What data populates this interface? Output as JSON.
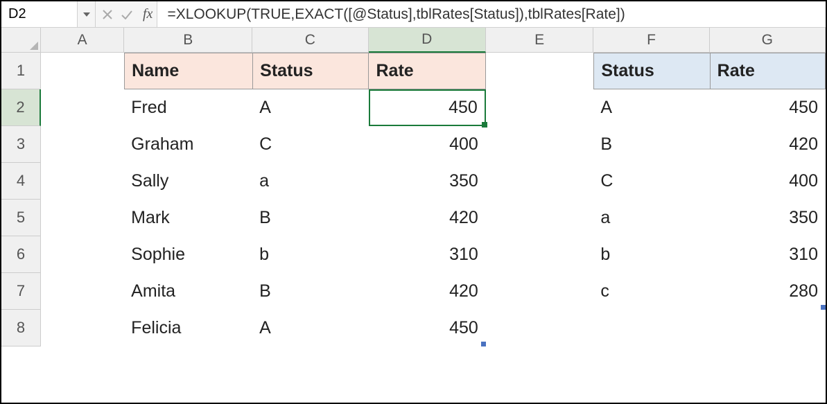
{
  "namebox": "D2",
  "fx_label": "fx",
  "formula": "=XLOOKUP(TRUE,EXACT([@Status],tblRates[Status]),tblRates[Rate])",
  "columns": [
    "A",
    "B",
    "C",
    "D",
    "E",
    "F",
    "G"
  ],
  "row_numbers": [
    "1",
    "2",
    "3",
    "4",
    "5",
    "6",
    "7",
    "8"
  ],
  "table1": {
    "headers": {
      "name": "Name",
      "status": "Status",
      "rate": "Rate"
    },
    "rows": [
      {
        "name": "Fred",
        "status": "A",
        "rate": "450"
      },
      {
        "name": "Graham",
        "status": "C",
        "rate": "400"
      },
      {
        "name": "Sally",
        "status": "a",
        "rate": "350"
      },
      {
        "name": "Mark",
        "status": "B",
        "rate": "420"
      },
      {
        "name": "Sophie",
        "status": "b",
        "rate": "310"
      },
      {
        "name": "Amita",
        "status": "B",
        "rate": "420"
      },
      {
        "name": "Felicia",
        "status": "A",
        "rate": "450"
      }
    ]
  },
  "table2": {
    "headers": {
      "status": "Status",
      "rate": "Rate"
    },
    "rows": [
      {
        "status": "A",
        "rate": "450"
      },
      {
        "status": "B",
        "rate": "420"
      },
      {
        "status": "C",
        "rate": "400"
      },
      {
        "status": "a",
        "rate": "350"
      },
      {
        "status": "b",
        "rate": "310"
      },
      {
        "status": "c",
        "rate": "280"
      }
    ]
  },
  "chart_data": {
    "type": "table",
    "tables": [
      {
        "title": "People",
        "columns": [
          "Name",
          "Status",
          "Rate"
        ],
        "rows": [
          [
            "Fred",
            "A",
            450
          ],
          [
            "Graham",
            "C",
            400
          ],
          [
            "Sally",
            "a",
            350
          ],
          [
            "Mark",
            "B",
            420
          ],
          [
            "Sophie",
            "b",
            310
          ],
          [
            "Amita",
            "B",
            420
          ],
          [
            "Felicia",
            "A",
            450
          ]
        ]
      },
      {
        "title": "tblRates",
        "columns": [
          "Status",
          "Rate"
        ],
        "rows": [
          [
            "A",
            450
          ],
          [
            "B",
            420
          ],
          [
            "C",
            400
          ],
          [
            "a",
            350
          ],
          [
            "b",
            310
          ],
          [
            "c",
            280
          ]
        ]
      }
    ]
  }
}
